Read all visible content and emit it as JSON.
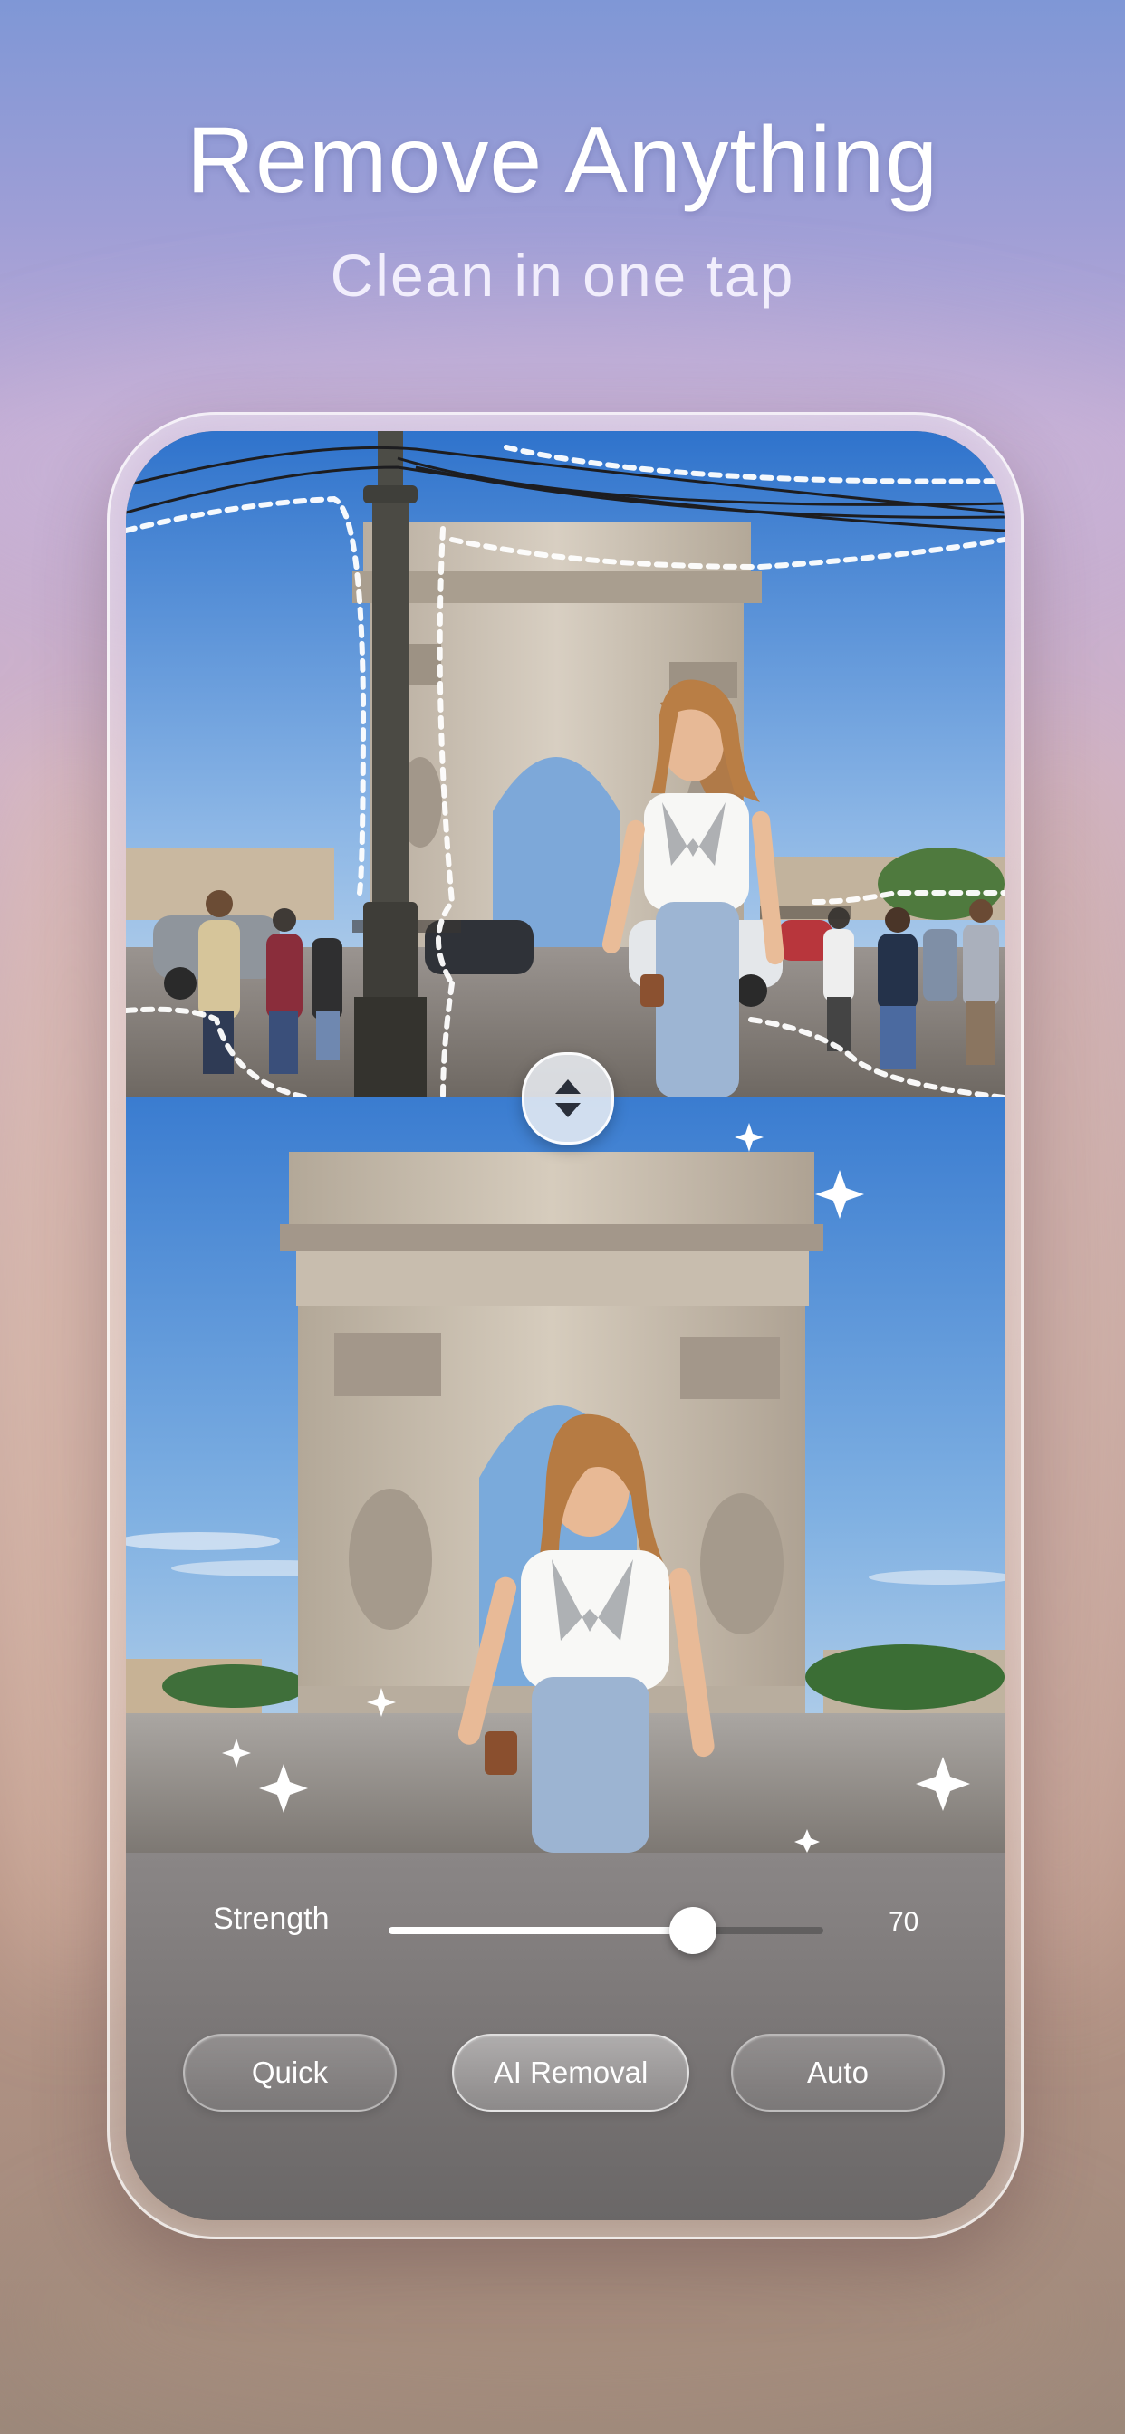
{
  "header": {
    "title": "Remove Anything",
    "subtitle": "Clean in one tap"
  },
  "editor": {
    "strength_label": "Strength",
    "strength_value": "70",
    "strength_level": 0.7,
    "modes": [
      {
        "label": "Quick",
        "active": false
      },
      {
        "label": "AI Removal",
        "active": true
      },
      {
        "label": "Auto",
        "active": false
      }
    ],
    "divider_handle_icon": "up-down-arrows-icon",
    "sparkle_icon": "sparkle-icon"
  },
  "colors": {
    "accent": "#ffffff",
    "background_top": "#7f97d6",
    "background_bottom": "#9c887a"
  }
}
